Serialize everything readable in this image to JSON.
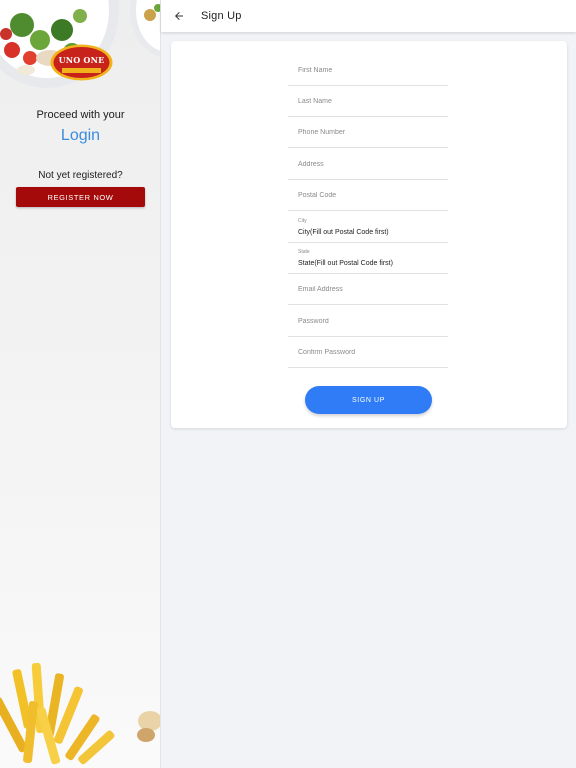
{
  "app_bar": {
    "title": "Sign Up",
    "back_icon": "arrow-left-icon"
  },
  "sidebar": {
    "logo_text": "UNO ONE",
    "proceed_text": "Proceed with your",
    "login_label": "Login",
    "not_registered_text": "Not yet registered?",
    "register_label": "REGISTER NOW"
  },
  "form": {
    "first_name": {
      "placeholder": "First Name",
      "value": ""
    },
    "last_name": {
      "placeholder": "Last Name",
      "value": ""
    },
    "phone": {
      "placeholder": "Phone Number",
      "value": ""
    },
    "address": {
      "placeholder": "Address",
      "value": ""
    },
    "postal_code": {
      "placeholder": "Postal Code",
      "value": ""
    },
    "city": {
      "label": "City",
      "value": "City(Fill out Postal Code first)"
    },
    "state": {
      "label": "State",
      "value": "State(Fill out Postal Code first)"
    },
    "email": {
      "placeholder": "Email Address",
      "value": ""
    },
    "password": {
      "placeholder": "Password",
      "value": ""
    },
    "confirm_password": {
      "placeholder": "Confirm Password",
      "value": ""
    },
    "submit_label": "SIGN UP"
  },
  "colors": {
    "brand_red": "#a40a0a",
    "accent_blue": "#2f7cf6",
    "link_blue": "#3a8dde",
    "background": "#f2f3f7"
  }
}
